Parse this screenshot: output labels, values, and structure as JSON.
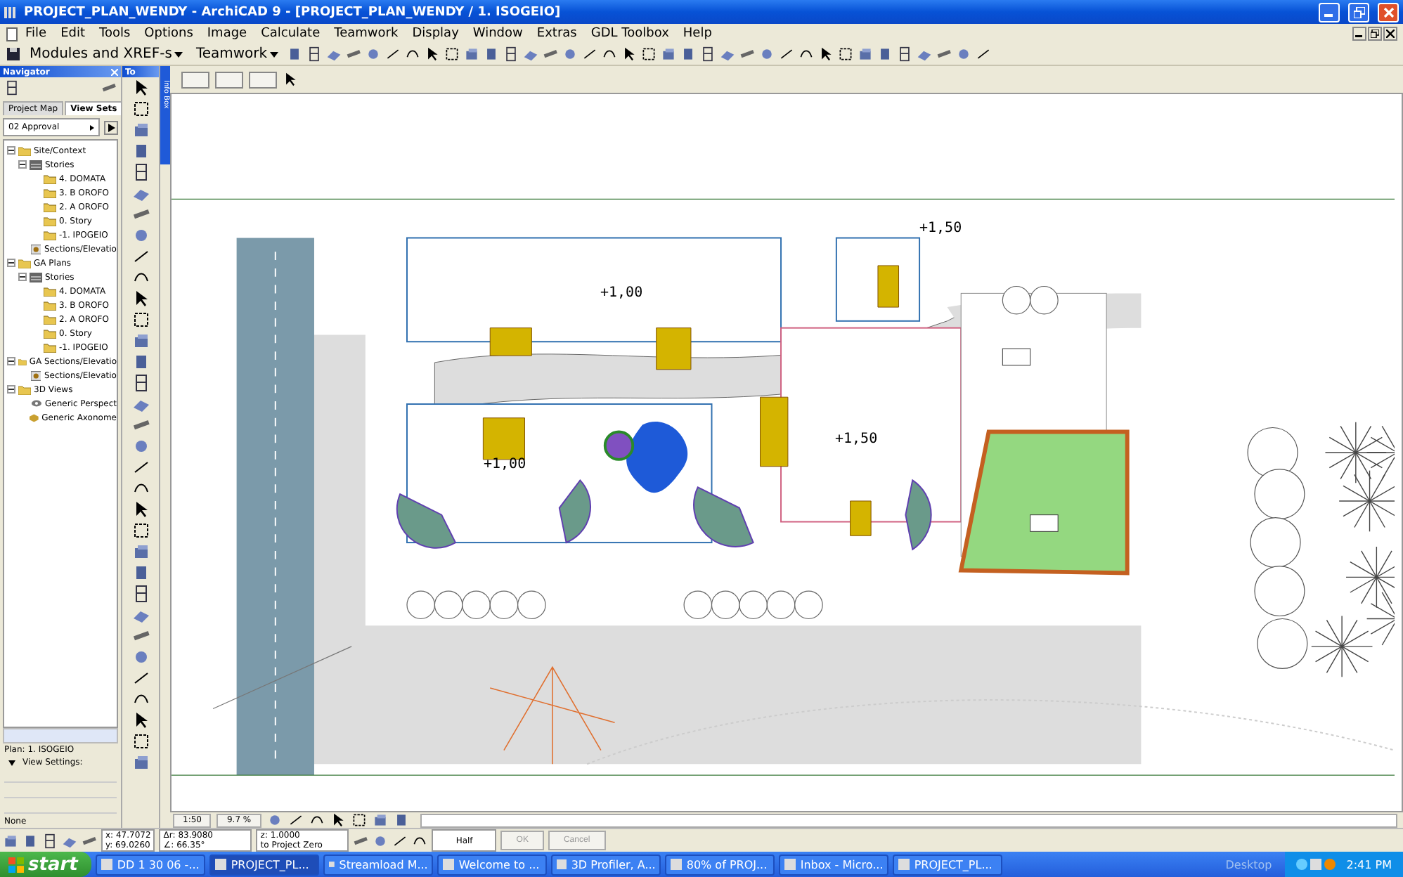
{
  "window": {
    "title": "PROJECT_PLAN_WENDY - ArchiCAD 9 - [PROJECT_PLAN_WENDY / 1. ISOGEIO]"
  },
  "menu": [
    "File",
    "Edit",
    "Tools",
    "Options",
    "Image",
    "Calculate",
    "Teamwork",
    "Display",
    "Window",
    "Extras",
    "GDL Toolbox",
    "Help"
  ],
  "toolbar": {
    "menus": [
      "Modules and XREF-s",
      "Teamwork"
    ]
  },
  "navigator": {
    "title": "Navigator",
    "tabs": [
      {
        "label": "Project Map",
        "selected": false
      },
      {
        "label": "View Sets",
        "selected": true
      }
    ],
    "view_set": "02 Approval",
    "tree": [
      {
        "label": "Site/Context",
        "kind": "folder",
        "expanded": true,
        "children": [
          {
            "label": "Stories",
            "kind": "stories",
            "expanded": true,
            "children": [
              {
                "label": "4. DOMATA",
                "kind": "story"
              },
              {
                "label": "3. B OROFO",
                "kind": "story"
              },
              {
                "label": "2. A OROFO",
                "kind": "story"
              },
              {
                "label": "0. Story",
                "kind": "story"
              },
              {
                "label": "-1. IPOGEIO",
                "kind": "story"
              }
            ]
          },
          {
            "label": "Sections/Elevatio",
            "kind": "section"
          }
        ]
      },
      {
        "label": "GA Plans",
        "kind": "folder",
        "expanded": true,
        "children": [
          {
            "label": "Stories",
            "kind": "stories",
            "expanded": true,
            "children": [
              {
                "label": "4. DOMATA",
                "kind": "story"
              },
              {
                "label": "3. B OROFO",
                "kind": "story"
              },
              {
                "label": "2. A OROFO",
                "kind": "story"
              },
              {
                "label": "0. Story",
                "kind": "story"
              },
              {
                "label": "-1. IPOGEIO",
                "kind": "story"
              }
            ]
          }
        ]
      },
      {
        "label": "GA Sections/Elevatio",
        "kind": "folder",
        "expanded": true,
        "children": [
          {
            "label": "Sections/Elevatio",
            "kind": "section"
          }
        ]
      },
      {
        "label": "3D Views",
        "kind": "folder",
        "expanded": true,
        "children": [
          {
            "label": "Generic Perspect",
            "kind": "perspective"
          },
          {
            "label": "Generic Axonome",
            "kind": "axonometric"
          }
        ]
      }
    ],
    "plan": "Plan: 1. ISOGEIO",
    "view_settings": "View Settings:",
    "filter": "None"
  },
  "toolbox": {
    "title": "To"
  },
  "info_box": {
    "title": "Info Box"
  },
  "plan_labels": [
    "+1,00",
    "+1,50",
    "+1,00",
    "+1,50"
  ],
  "view_bar": {
    "scale": "1:50",
    "zoom": "9.7 %"
  },
  "coordinates": {
    "x": "x: 47.7072",
    "y": "y: 69.0260",
    "dr": "Δr: 83.9080",
    "angle": "∠: 66.35°",
    "z": "z: 1.0000",
    "reference": "to Project Zero",
    "gravity": "Half",
    "ok": "OK",
    "cancel": "Cancel"
  },
  "taskbar": {
    "start": "start",
    "items": [
      {
        "label": "DD 1 30 06 -...",
        "selected": false
      },
      {
        "label": "PROJECT_PL...",
        "selected": true
      },
      {
        "label": "Streamload M...",
        "selected": false
      },
      {
        "label": "Welcome to ...",
        "selected": false
      },
      {
        "label": "3D Profiler, A...",
        "selected": false
      },
      {
        "label": "80% of PROJ...",
        "selected": false
      },
      {
        "label": "Inbox - Micro...",
        "selected": false
      },
      {
        "label": "PROJECT_PL...",
        "selected": false
      }
    ],
    "desktop": "Desktop",
    "clock": "2:41 PM"
  }
}
